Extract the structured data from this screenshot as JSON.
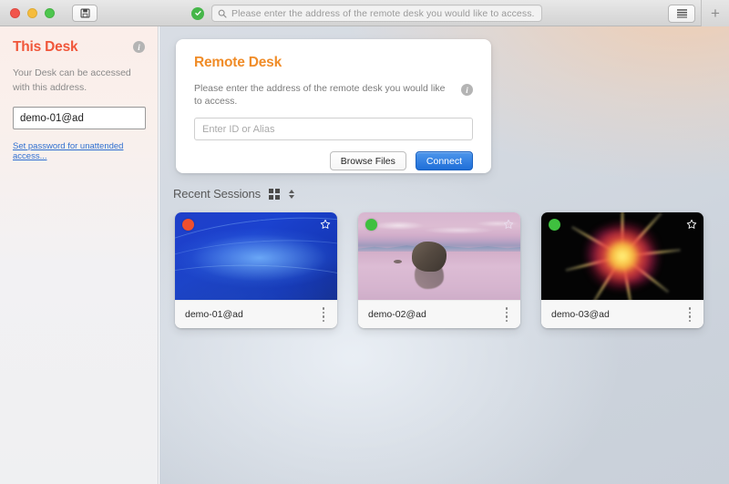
{
  "titlebar": {
    "save_icon": "save-disk-icon",
    "status_icon": "green-check-icon",
    "search_placeholder": "Please enter the address of the remote desk you would like to access.",
    "search_value": "",
    "search_icon": "magnifier-icon",
    "list_icon": "list-view-icon",
    "plus_label": "+"
  },
  "sidebar": {
    "title": "This Desk",
    "info_icon": "info-icon",
    "info_glyph": "i",
    "description": "Your Desk can be accessed with this address.",
    "address_value": "demo-01@ad",
    "password_link": "Set password for unattended access...",
    "title_color": "#f0563a"
  },
  "remote_desk": {
    "title": "Remote Desk",
    "title_color": "#f08c28",
    "description": "Please enter the address of the remote desk you would like to access.",
    "info_icon": "info-icon",
    "info_glyph": "i",
    "input_placeholder": "Enter ID or Alias",
    "input_value": "",
    "browse_label": "Browse Files",
    "connect_label": "Connect",
    "connect_color": "#2f7ee0"
  },
  "sessions": {
    "heading": "Recent Sessions",
    "grid_icon": "grid-view-icon",
    "sort_icon": "sort-chevrons-icon",
    "items": [
      {
        "label": "demo-01@ad",
        "status": "offline",
        "status_color": "#ef4f2e",
        "thumb": "blue-abstract-wallpaper",
        "star_icon": "star-outline-icon",
        "star_color": "#ffffff",
        "menu_icon": "kebab-menu-icon"
      },
      {
        "label": "demo-02@ad",
        "status": "online",
        "status_color": "#3fc03f",
        "thumb": "pink-lake-rock-wallpaper",
        "star_icon": "star-outline-icon",
        "star_color": "#e9dced",
        "menu_icon": "kebab-menu-icon"
      },
      {
        "label": "demo-03@ad",
        "status": "online",
        "status_color": "#3fc03f",
        "thumb": "colorful-burst-wallpaper",
        "star_icon": "star-outline-icon",
        "star_color": "#ffffff",
        "menu_icon": "kebab-menu-icon"
      }
    ]
  }
}
